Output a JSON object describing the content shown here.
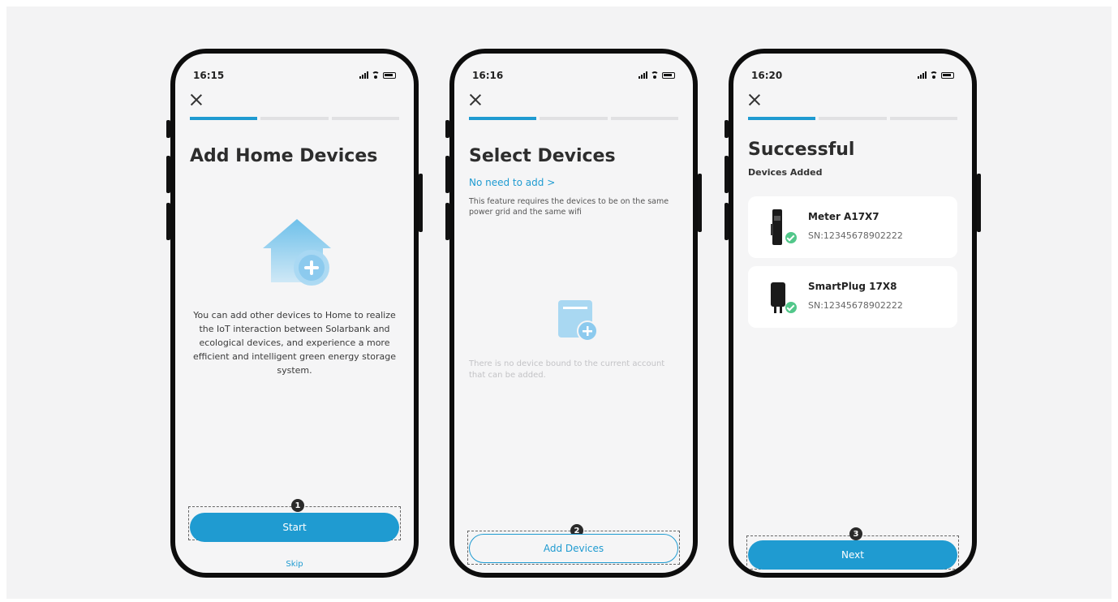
{
  "phones": [
    {
      "time": "16:15",
      "title": "Add Home Devices",
      "description": "You can add other devices to Home to realize the IoT interaction between Solarbank and ecological devices, and experience a more efficient and intelligent green energy storage system.",
      "primary_button": "Start",
      "secondary_link": "Skip",
      "step_marker": "1",
      "progress_active": 1
    },
    {
      "time": "16:16",
      "title": "Select Devices",
      "link": "No need to add >",
      "note": "This feature requires the devices to be on the same power grid and the same wifi",
      "empty_text": "There is no device bound to the current account that can be added.",
      "button": "Add Devices",
      "step_marker": "2",
      "progress_active": 1
    },
    {
      "time": "16:20",
      "title": "Successful",
      "subtitle": "Devices Added",
      "devices": [
        {
          "name": "Meter A17X7",
          "sn": "SN:12345678902222",
          "icon": "meter-icon"
        },
        {
          "name": "SmartPlug 17X8",
          "sn": "SN:12345678902222",
          "icon": "smartplug-icon"
        }
      ],
      "button": "Next",
      "step_marker": "3",
      "progress_active": 1
    }
  ],
  "colors": {
    "accent": "#1f9bd1",
    "success": "#52c78a",
    "background": "#f3f3f4"
  }
}
